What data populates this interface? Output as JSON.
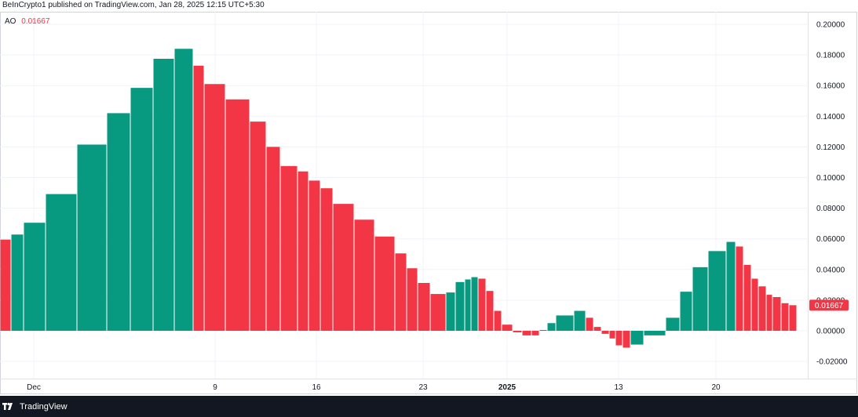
{
  "header": {
    "published_line": "BeInCrypto1 published on TradingView.com, Jan 28, 2025 12:15 UTC+5:30"
  },
  "legend": {
    "indicator": "AO",
    "value": "0.01667"
  },
  "footer": {
    "brand": "TradingView",
    "logo_icon": "tradingview-logo-icon"
  },
  "colors": {
    "rising": "#089981",
    "falling": "#f23645",
    "grid": "#f0f3fa",
    "axis_text": "#131722",
    "price_label_bg": "#f23645"
  },
  "chart_data": {
    "type": "bar",
    "indicator": "Awesome Oscillator",
    "y_ticks": [
      "0.20000",
      "0.18000",
      "0.16000",
      "0.14000",
      "0.12000",
      "0.10000",
      "0.08000",
      "0.06000",
      "0.04000",
      "0.02000",
      "0.00000",
      "-0.02000"
    ],
    "ylim": [
      -0.024,
      0.2
    ],
    "x_ticks": [
      "Dec",
      "9",
      "16",
      "23",
      "2025",
      "13",
      "20"
    ],
    "current_value_label": "0.01667",
    "grid": true,
    "bars": [
      {
        "v": 0.0595,
        "dir": "down"
      },
      {
        "v": 0.0628,
        "dir": "up"
      },
      {
        "v": 0.0705,
        "dir": "up"
      },
      {
        "v": 0.0892,
        "dir": "up"
      },
      {
        "v": 0.1215,
        "dir": "up"
      },
      {
        "v": 0.142,
        "dir": "up"
      },
      {
        "v": 0.1585,
        "dir": "up"
      },
      {
        "v": 0.1775,
        "dir": "up"
      },
      {
        "v": 0.184,
        "dir": "up"
      },
      {
        "v": 0.173,
        "dir": "down"
      },
      {
        "v": 0.161,
        "dir": "down"
      },
      {
        "v": 0.151,
        "dir": "down"
      },
      {
        "v": 0.1365,
        "dir": "down"
      },
      {
        "v": 0.12,
        "dir": "down"
      },
      {
        "v": 0.1075,
        "dir": "down"
      },
      {
        "v": 0.104,
        "dir": "down"
      },
      {
        "v": 0.098,
        "dir": "down"
      },
      {
        "v": 0.093,
        "dir": "down"
      },
      {
        "v": 0.0828,
        "dir": "down"
      },
      {
        "v": 0.0725,
        "dir": "down"
      },
      {
        "v": 0.0615,
        "dir": "down"
      },
      {
        "v": 0.0505,
        "dir": "down"
      },
      {
        "v": 0.0408,
        "dir": "down"
      },
      {
        "v": 0.0312,
        "dir": "down"
      },
      {
        "v": 0.024,
        "dir": "down"
      },
      {
        "v": 0.025,
        "dir": "up"
      },
      {
        "v": 0.0318,
        "dir": "up"
      },
      {
        "v": 0.0335,
        "dir": "up"
      },
      {
        "v": 0.035,
        "dir": "up"
      },
      {
        "v": 0.034,
        "dir": "down"
      },
      {
        "v": 0.026,
        "dir": "down"
      },
      {
        "v": 0.013,
        "dir": "down"
      },
      {
        "v": 0.004,
        "dir": "down"
      },
      {
        "v": -0.001,
        "dir": "down"
      },
      {
        "v": -0.003,
        "dir": "down"
      },
      {
        "v": -0.003,
        "dir": "down"
      },
      {
        "v": 0.0005,
        "dir": "up"
      },
      {
        "v": 0.005,
        "dir": "up"
      },
      {
        "v": 0.01,
        "dir": "up"
      },
      {
        "v": 0.013,
        "dir": "up"
      },
      {
        "v": 0.0085,
        "dir": "down"
      },
      {
        "v": 0.0025,
        "dir": "down"
      },
      {
        "v": -0.002,
        "dir": "down"
      },
      {
        "v": -0.005,
        "dir": "down"
      },
      {
        "v": -0.0095,
        "dir": "down"
      },
      {
        "v": -0.011,
        "dir": "down"
      },
      {
        "v": -0.009,
        "dir": "up"
      },
      {
        "v": -0.003,
        "dir": "up"
      },
      {
        "v": 0.0085,
        "dir": "up"
      },
      {
        "v": 0.0255,
        "dir": "up"
      },
      {
        "v": 0.0415,
        "dir": "up"
      },
      {
        "v": 0.052,
        "dir": "up"
      },
      {
        "v": 0.058,
        "dir": "up"
      },
      {
        "v": 0.055,
        "dir": "down"
      },
      {
        "v": 0.043,
        "dir": "down"
      },
      {
        "v": 0.034,
        "dir": "down"
      },
      {
        "v": 0.029,
        "dir": "down"
      },
      {
        "v": 0.0235,
        "dir": "down"
      },
      {
        "v": 0.022,
        "dir": "down"
      },
      {
        "v": 0.018,
        "dir": "down"
      },
      {
        "v": 0.0167,
        "dir": "down"
      }
    ]
  }
}
